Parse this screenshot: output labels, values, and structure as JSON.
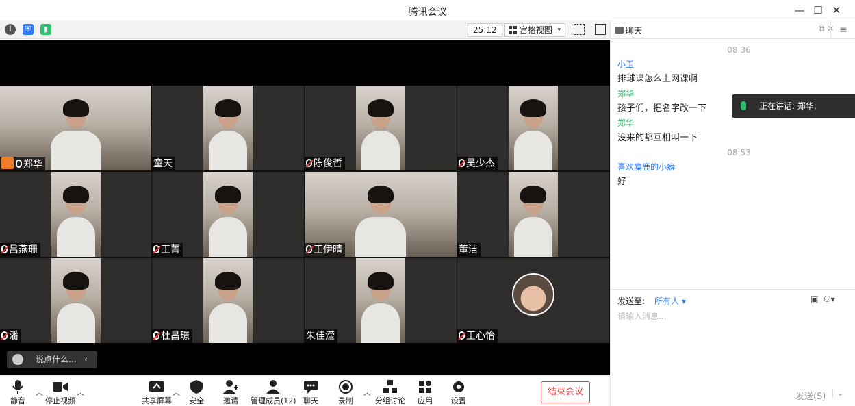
{
  "window": {
    "title": "腾讯会议",
    "min": "—",
    "max": "☐",
    "close": "✕"
  },
  "toolbar": {
    "timer": "25:12",
    "view_label": "宫格视图",
    "view_caret": "▾",
    "info_icon": "i",
    "shield_icon": "⛨",
    "signal_icon": "▮"
  },
  "participants": [
    {
      "name": "郑华",
      "host": true,
      "muted": false,
      "active": true
    },
    {
      "name": "童天",
      "muted": false
    },
    {
      "name": "陈俊哲",
      "muted": true
    },
    {
      "name": "吴少杰",
      "muted": true
    },
    {
      "name": "吕燕珊",
      "muted": true
    },
    {
      "name": "王菁",
      "muted": true
    },
    {
      "name": "王伊晴",
      "muted": true
    },
    {
      "name": "董洁",
      "muted": false
    },
    {
      "name": "潘",
      "muted": true
    },
    {
      "name": "杜昌璟",
      "muted": true
    },
    {
      "name": "朱佳滢",
      "muted": false
    },
    {
      "name": "王心怡",
      "muted": true
    }
  ],
  "overlay": {
    "chat_placeholder": "说点什么...",
    "speaking": "正在讲话: 郑华;"
  },
  "bottom": {
    "mute": "静音",
    "stop_video": "停止视频",
    "share": "共享屏幕",
    "security": "安全",
    "invite": "邀请",
    "members": "管理成员(12)",
    "chat": "聊天",
    "record": "录制",
    "breakout": "分组讨论",
    "apps": "应用",
    "settings": "设置",
    "end": "结束会议"
  },
  "chat": {
    "title": "聊天",
    "messages": [
      {
        "time": "08:36"
      },
      {
        "sender": "小玉",
        "color": "#2f7cf6",
        "text": "排球课怎么上网课啊"
      },
      {
        "sender": "郑华",
        "color": "#2fbf71",
        "text": "孩子们，把名字改一下"
      },
      {
        "sender": "郑华",
        "color": "#2fbf71",
        "text": "没来的都互相叫一下"
      },
      {
        "time": "08:53"
      },
      {
        "sender": "喜欢麋鹿的小癖",
        "color": "#2f7cf6",
        "text": "好"
      }
    ],
    "send_to": "发送至:",
    "send_target": "所有人 ▾",
    "placeholder": "请输入消息...",
    "send_button": "发送(S)",
    "send_caret": "⌄"
  }
}
